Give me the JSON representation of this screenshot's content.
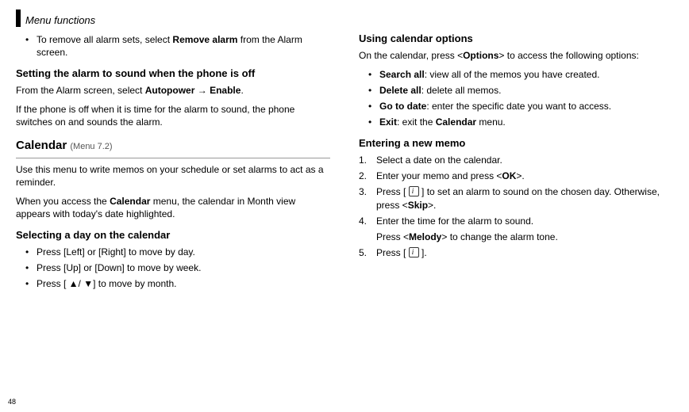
{
  "header": {
    "title": "Menu functions"
  },
  "page_number": "48",
  "col1": {
    "remove_bullet_pre": "To remove all alarm sets, select ",
    "remove_bullet_bold": "Remove alarm",
    "remove_bullet_post": " from the Alarm screen.",
    "h_autopower": "Setting the alarm to sound when the phone is off",
    "autopower_p1_pre": "From the Alarm screen, select ",
    "autopower_p1_b1": "Autopower",
    "autopower_p1_mid": " → ",
    "autopower_p1_b2": "Enable",
    "autopower_p1_post": ".",
    "autopower_p2": "If the phone is off when it is time for the alarm to sound, the phone switches on and sounds the alarm.",
    "h_calendar": "Calendar",
    "calendar_menu_ref": "(Menu 7.2)",
    "calendar_p1": "Use this menu to write memos on your schedule or set alarms to act as a reminder.",
    "calendar_p2_pre": "When you access the ",
    "calendar_p2_bold": "Calendar",
    "calendar_p2_post": " menu, the calendar in Month view appears with today's date highlighted.",
    "h_selectday": "Selecting a day on the calendar",
    "selectday_b1": "Press [Left] or [Right] to move by day.",
    "selectday_b2": "Press [Up] or [Down] to move by week.",
    "selectday_b3": "Press [ ▲/ ▼] to move by month."
  },
  "col2": {
    "h_using": "Using calendar options",
    "using_p_pre": "On the calendar, press <",
    "using_p_bold": "Options",
    "using_p_post": "> to access the following options:",
    "opt1_bold": "Search all",
    "opt1_rest": ": view all of the memos you have created.",
    "opt2_bold": "Delete all",
    "opt2_rest": ": delete all memos.",
    "opt3_bold": "Go to date",
    "opt3_rest": ": enter the specific date you want to access.",
    "opt4_bold": "Exit",
    "opt4_mid": ": exit the ",
    "opt4_bold2": "Calendar",
    "opt4_rest": " menu.",
    "h_entering": "Entering a new memo",
    "step1_num": "1.",
    "step1_text": "Select a date on the calendar.",
    "step2_num": "2.",
    "step2_pre": "Enter your memo and press <",
    "step2_bold": "OK",
    "step2_post": ">.",
    "step3_num": "3.",
    "step3_pre": "Press [ ",
    "step3_mid": " ] to set an alarm to sound on the chosen day. Otherwise, press <",
    "step3_bold": "Skip",
    "step3_post": ">.",
    "step4_num": "4.",
    "step4_text": "Enter the time for the alarm to sound.",
    "step4_sub_pre": "Press <",
    "step4_sub_bold": "Melody",
    "step4_sub_post": "> to change the alarm tone.",
    "step5_num": "5.",
    "step5_pre": "Press [ ",
    "step5_post": " ]."
  }
}
